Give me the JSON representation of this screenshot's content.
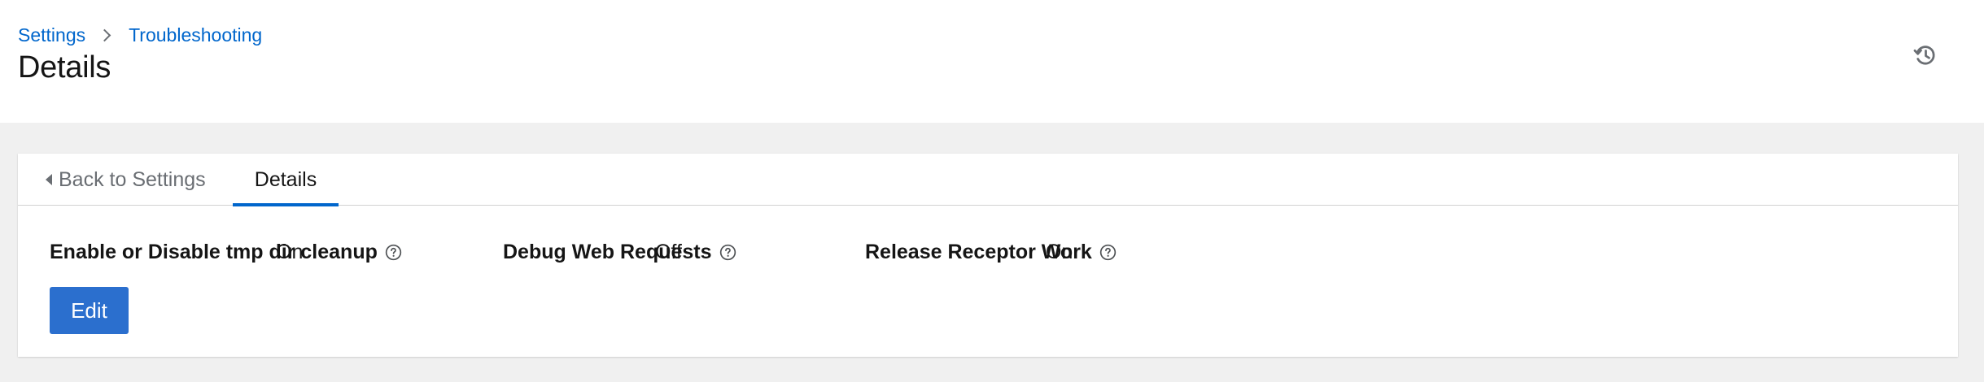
{
  "breadcrumb": {
    "items": [
      "Settings",
      "Troubleshooting"
    ]
  },
  "page": {
    "title": "Details"
  },
  "header_actions": {
    "history_icon": "history-icon"
  },
  "tabs": {
    "back_label": "Back to Settings",
    "details_label": "Details",
    "active_color": "#0066cc"
  },
  "fields": [
    {
      "label": "Enable or Disable tmp dir cleanup",
      "value": "On"
    },
    {
      "label": "Debug Web Requests",
      "value": "Off"
    },
    {
      "label": "Release Receptor Work",
      "value": "On"
    }
  ],
  "actions": {
    "edit_label": "Edit",
    "primary_color": "#2b6fce"
  }
}
